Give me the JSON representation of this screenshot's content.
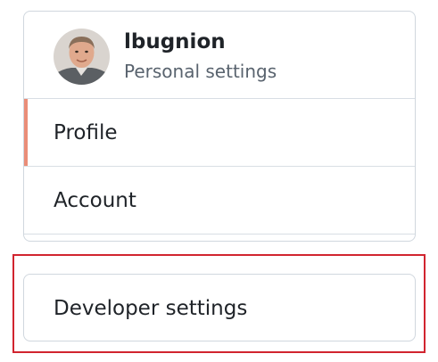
{
  "user": {
    "name": "lbugnion",
    "subtitle": "Personal settings"
  },
  "nav": {
    "items": [
      {
        "label": "Profile",
        "active": true
      },
      {
        "label": "Account",
        "active": false
      }
    ],
    "developer_settings": "Developer settings"
  },
  "colors": {
    "active_indicator": "#ea8d78",
    "highlight_border": "#d1242f",
    "border": "#d0d7de",
    "muted_text": "#59636e"
  }
}
